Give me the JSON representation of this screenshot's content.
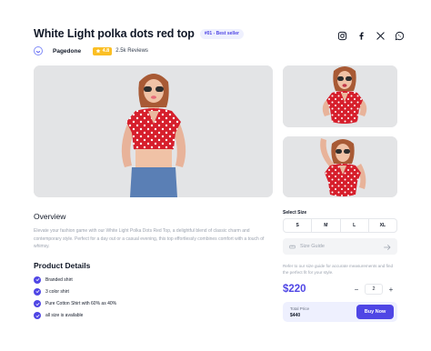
{
  "product": {
    "title": "White Light polka dots red top",
    "badge": "#01 - Best seller",
    "brand": "Pagedone",
    "rating": "4.8",
    "reviews": "2.5k Reviews"
  },
  "social": {
    "icons": [
      "instagram-icon",
      "facebook-icon",
      "x-icon",
      "whatsapp-icon"
    ]
  },
  "overview": {
    "heading": "Overview",
    "text": "Elevate your fashion game with our White Light Polka Dots Red Top, a delightful blend of classic charm and contemporary style. Perfect for a day out or a casual evening, this top effortlessly combines comfort with a touch of whimsy."
  },
  "details": {
    "heading": "Product Details",
    "items": [
      "Branded shirt",
      "3 color shirt",
      "Pure Cotton Shirt with 60% as 40%",
      "all size is available"
    ]
  },
  "size": {
    "label": "Select Size",
    "options": [
      "S",
      "M",
      "L",
      "XL"
    ],
    "guide_label": "Size Guide",
    "note": "Refer to our size guide for accurate measurements and find the perfect fit for your style."
  },
  "purchase": {
    "price": "$220",
    "quantity": "2",
    "minus": "−",
    "plus": "+",
    "total_label": "Total Price",
    "total_value": "$440",
    "buy_label": "Buy Now"
  },
  "colors": {
    "accent": "#4f46e5",
    "rating_bg": "#fbbf24",
    "photo_bg": "#e3e4e6",
    "shirt": "#d61f2c"
  }
}
